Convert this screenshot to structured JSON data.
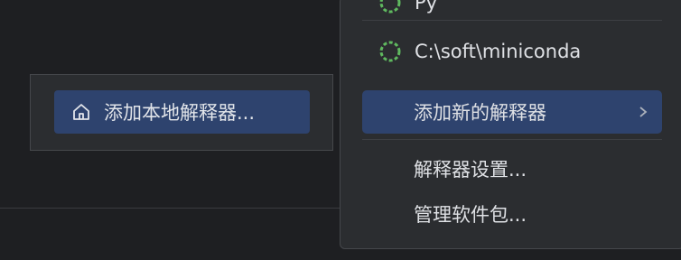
{
  "left_panel": {
    "add_local_button": {
      "icon": "home-icon",
      "label": "添加本地解释器..."
    }
  },
  "popup_menu": {
    "partial_top_item": "Py",
    "interpreter_item": {
      "icon": "loading-spinner-icon",
      "label": "C:\\soft\\miniconda"
    },
    "add_new_item": {
      "label": "添加新的解释器",
      "icon": "chevron-right-icon"
    },
    "settings_item": {
      "label": "解释器设置..."
    },
    "packages_item": {
      "label": "管理软件包..."
    }
  },
  "colors": {
    "background": "#1e1f22",
    "panel": "#2b2d30",
    "selection": "#2e436e",
    "spinner": "#5fb95f"
  }
}
